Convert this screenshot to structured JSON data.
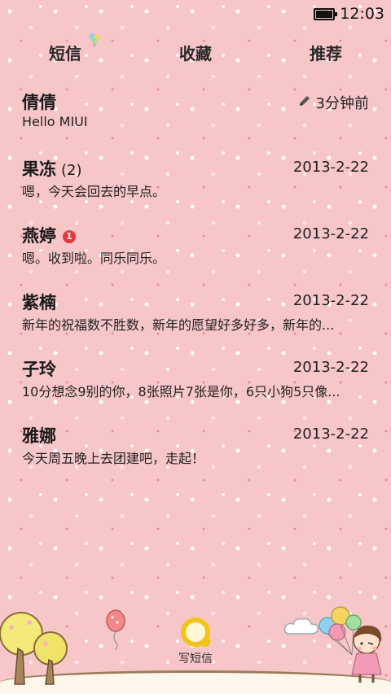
{
  "status": {
    "time": "12:03"
  },
  "tabs": [
    {
      "label": "短信"
    },
    {
      "label": "收藏"
    },
    {
      "label": "推荐"
    }
  ],
  "conversations": [
    {
      "name": "倩倩",
      "count": "",
      "unread": "",
      "time": "3分钟前",
      "draft": true,
      "preview": "Hello MIUI"
    },
    {
      "name": "果冻",
      "count": "(2)",
      "unread": "",
      "time": "2013-2-22",
      "draft": false,
      "preview": "嗯，今天会回去的早点。"
    },
    {
      "name": "燕婷",
      "count": "",
      "unread": "1",
      "time": "2013-2-22",
      "draft": false,
      "preview": "嗯。收到啦。同乐同乐。"
    },
    {
      "name": "紫楠",
      "count": "",
      "unread": "",
      "time": "2013-2-22",
      "draft": false,
      "preview": "新年的祝福数不胜数，新年的愿望好多好多，新年的..."
    },
    {
      "name": "子玲",
      "count": "",
      "unread": "",
      "time": "2013-2-22",
      "draft": false,
      "preview": "10分想念9别的你，8张照片7张是你，6只小狗5只像..."
    },
    {
      "name": "雅娜",
      "count": "",
      "unread": "",
      "time": "2013-2-22",
      "draft": false,
      "preview": "今天周五晚上去团建吧，走起！"
    }
  ],
  "footer": {
    "compose_label": "写短信"
  },
  "colors": {
    "background": "#f7c6c8",
    "accent": "#f0c419",
    "badge": "#e33b3b"
  }
}
